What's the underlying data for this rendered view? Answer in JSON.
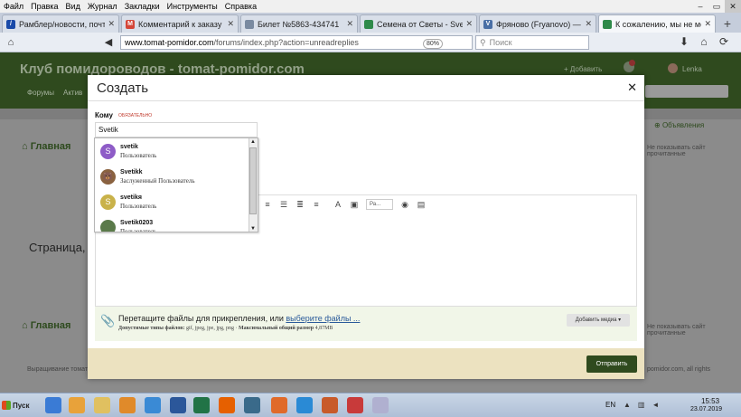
{
  "menubar": {
    "items": [
      "Файл",
      "Правка",
      "Вид",
      "Журнал",
      "Закладки",
      "Инструменты",
      "Справка"
    ]
  },
  "tabs": [
    {
      "title": "Рамблер/новости, почта и",
      "icon": "rambler-icon",
      "color": "#1a4aa8",
      "glyph": "/"
    },
    {
      "title": "Комментарий к заказу на",
      "icon": "gmail-icon",
      "color": "#d44638",
      "glyph": "M"
    },
    {
      "title": "Билет №5863-434741",
      "icon": "page-icon",
      "color": "#7a8aa0",
      "glyph": ""
    },
    {
      "title": "Семена от Светы - Svetik",
      "icon": "forum-icon",
      "color": "#2f8a4a",
      "glyph": ""
    },
    {
      "title": "Фряново (Fryanovo) — Ver",
      "icon": "vk-icon",
      "color": "#4a6fa5",
      "glyph": "V"
    },
    {
      "title": "К сожалению, мы не могли",
      "icon": "forum-icon",
      "color": "#2f8a4a",
      "glyph": ""
    }
  ],
  "nav": {
    "url_domain": "www.tomat-pomidor.com",
    "url_path": "/forums/index.php?action=unreadreplies",
    "zoom": "80%",
    "search_placeholder": "Поиск"
  },
  "site": {
    "title": "Клуб помидороводов - tomat-pomidor.com",
    "nav1": "Форумы",
    "nav2": "Актив",
    "add": "Добавить",
    "user": "Lenka",
    "home": "Главная",
    "objavleniya": "Объявления",
    "strana": "Страница, к",
    "footer": "Выращивание томатов",
    "r1": "Не показывать сайт прочитанные",
    "r2": "Не показывать сайт прочитанные",
    "r3": "pomidor.com, all rights"
  },
  "modal": {
    "title": "Создать",
    "to_label": "Кому",
    "required": "ОБЯЗАТЕЛЬНО",
    "to_value": "Svetik",
    "attach_text": "Перетащите файлы для прикрепления, или",
    "attach_link": "выберите файлы ...",
    "attach_types_label": "Допустимые типы файлов:",
    "attach_types": "gif, jpeg, jpe, jpg, png",
    "max_size_label": "Максимальный общий размер",
    "max_size": "4,87MB",
    "media_button": "Добавить медиа",
    "send_button": "Отправить",
    "font_select": "Ра..."
  },
  "autocomplete": [
    {
      "name": "svetik",
      "role": "Пользователь",
      "avatar_letter": "S",
      "avatar_color": "#8e5cc7"
    },
    {
      "name": "Svetikk",
      "role": "Заслуженный Пользователь",
      "avatar_letter": "",
      "avatar_color": "#8a6240"
    },
    {
      "name": "svetikя",
      "role": "Пользователь",
      "avatar_letter": "S",
      "avatar_color": "#c9b24a"
    },
    {
      "name": "Svetik0203",
      "role": "Пользователь",
      "avatar_letter": "",
      "avatar_color": "#5a7a4a"
    }
  ],
  "taskbar": {
    "start": "Пуск",
    "lang": "EN",
    "time": "15:53",
    "date": "23.07.2019"
  }
}
